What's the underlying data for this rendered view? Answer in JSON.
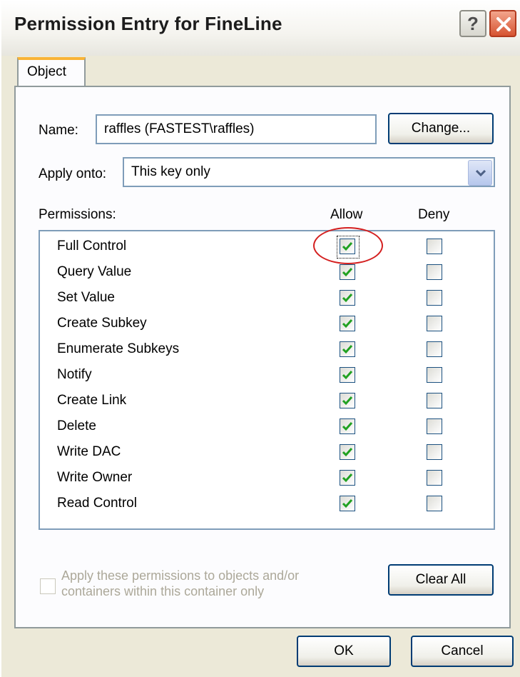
{
  "dialog": {
    "title": "Permission Entry for FineLine",
    "help_glyph": "?",
    "tab_object": "Object",
    "name_label": "Name:",
    "name_value": "raffles (FASTEST\\raffles)",
    "change_button": "Change...",
    "apply_label": "Apply onto:",
    "apply_value": "This key only",
    "permissions_header": "Permissions:",
    "allow_header": "Allow",
    "deny_header": "Deny",
    "permissions": [
      {
        "label": "Full Control",
        "allow": true,
        "deny": false
      },
      {
        "label": "Query Value",
        "allow": true,
        "deny": false
      },
      {
        "label": "Set Value",
        "allow": true,
        "deny": false
      },
      {
        "label": "Create Subkey",
        "allow": true,
        "deny": false
      },
      {
        "label": "Enumerate Subkeys",
        "allow": true,
        "deny": false
      },
      {
        "label": "Notify",
        "allow": true,
        "deny": false
      },
      {
        "label": "Create Link",
        "allow": true,
        "deny": false
      },
      {
        "label": "Delete",
        "allow": true,
        "deny": false
      },
      {
        "label": "Write DAC",
        "allow": true,
        "deny": false
      },
      {
        "label": "Write Owner",
        "allow": true,
        "deny": false
      },
      {
        "label": "Read Control",
        "allow": true,
        "deny": false
      }
    ],
    "apply_children_line1": "Apply these permissions to objects and/or",
    "apply_children_line2": "containers within this container only",
    "clear_all_button": "Clear All",
    "ok_button": "OK",
    "cancel_button": "Cancel"
  },
  "colors": {
    "dialog_bg": "#ece9d8",
    "check_green": "#21a121",
    "highlight_red": "#d42020",
    "tab_accent": "#f9b437"
  }
}
